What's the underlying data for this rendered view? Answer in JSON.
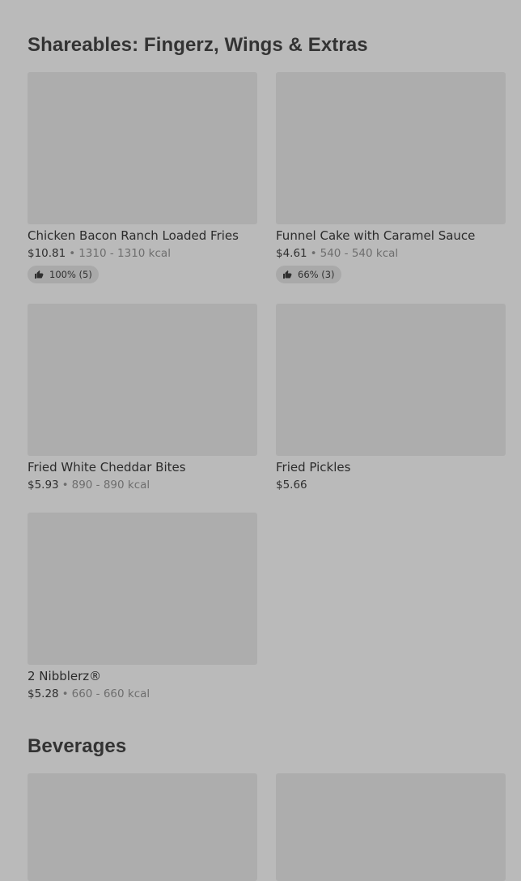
{
  "sections": [
    {
      "title": "Shareables: Fingerz, Wings & Extras",
      "items": [
        {
          "name": "Chicken Bacon Ranch Loaded Fries",
          "price": "$10.81",
          "separator": "•",
          "calories": "1310 - 1310 kcal",
          "rating": "100% (5)"
        },
        {
          "name": "Funnel Cake with Caramel Sauce",
          "price": "$4.61",
          "separator": "•",
          "calories": "540 - 540 kcal",
          "rating": "66% (3)"
        },
        {
          "name": "Fried White Cheddar Bites",
          "price": "$5.93",
          "separator": "•",
          "calories": "890 - 890 kcal"
        },
        {
          "name": "Fried Pickles",
          "price": "$5.66"
        },
        {
          "name": "2 Nibblerz®",
          "price": "$5.28",
          "separator": "•",
          "calories": "660 - 660 kcal"
        }
      ]
    },
    {
      "title": "Beverages"
    }
  ],
  "icons": {
    "rating": "thumbs-up-icon"
  },
  "colors": {
    "background": "#bababa",
    "image_placeholder": "#adadad",
    "text": "#2b2b2b",
    "muted_text": "#6e6e6e"
  }
}
